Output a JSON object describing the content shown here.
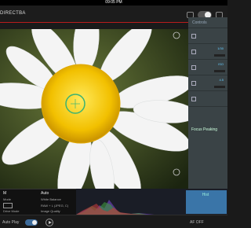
{
  "status_bar": {
    "time": "09:05 PM"
  },
  "header": {
    "title": "DIRECTBA"
  },
  "sidepanel": {
    "header": "Controls",
    "rows": [
      {
        "value": ""
      },
      {
        "value": "1/30"
      },
      {
        "value": "ISO"
      },
      {
        "value": "4.5"
      },
      {
        "value": ""
      }
    ],
    "focus_peaking": "Focus Peaking"
  },
  "bottom": {
    "mode_value": "M",
    "mode_label": "Mode",
    "wb_value": "Auto",
    "wb_label": "White Balance",
    "drive_label": "Drive Mode",
    "raw_label": "RAW + L (JPEG, C)",
    "quality_label": "Image Quality",
    "histogram_label": "Hist"
  },
  "footer": {
    "autoplay_label": "Auto Play",
    "af_label": "AF OFF"
  },
  "colors": {
    "accent_red": "#b91c1c",
    "panel": "#3a4346",
    "focus_ring": "#3cb371"
  }
}
